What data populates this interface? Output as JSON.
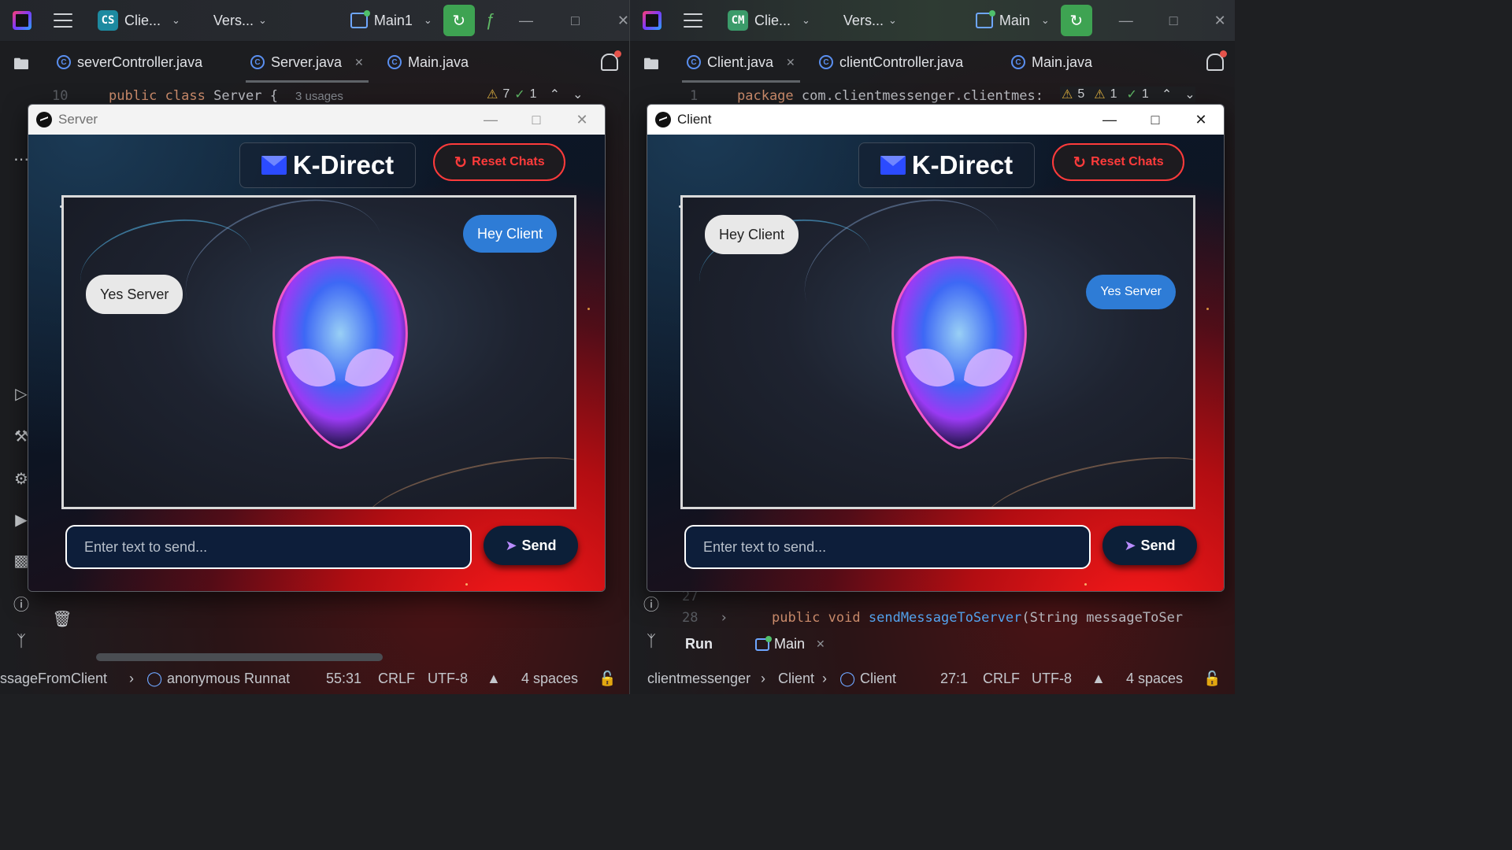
{
  "left_ide": {
    "project_badge": "CS",
    "project_name": "Clie...",
    "vcs_label": "Vers...",
    "run_config": "Main1",
    "tabs": [
      {
        "label": "severController.java",
        "active": false
      },
      {
        "label": "Server.java",
        "active": true
      },
      {
        "label": "Main.java",
        "active": false
      }
    ],
    "code_line_number": "10",
    "code_kw1": "public",
    "code_kw2": "class",
    "code_name": "Server {",
    "code_hint": "3 usages",
    "inspections": {
      "warnings": "7",
      "ok": "1"
    },
    "status": {
      "breadcrumb1": "ssageFromClient",
      "breadcrumb2": "anonymous Runnat",
      "position": "55:31",
      "line_sep": "CRLF",
      "encoding": "UTF-8",
      "indent": "4 spaces"
    }
  },
  "right_ide": {
    "project_badge": "CM",
    "project_name": "Clie...",
    "vcs_label": "Vers...",
    "run_config": "Main",
    "tabs": [
      {
        "label": "Client.java",
        "active": true
      },
      {
        "label": "clientController.java",
        "active": false
      },
      {
        "label": "Main.java",
        "active": false
      }
    ],
    "code_line_number": "1",
    "code_kw": "package",
    "code_rest": "com.clientmessenger.clientmes:",
    "inspections": {
      "errors": "5",
      "warnings": "1",
      "ok": "1"
    },
    "code_line_27": "27",
    "code_line_28": "28",
    "code_28_kw1": "public",
    "code_28_kw2": "void",
    "code_28_fn": "sendMessageToServer",
    "code_28_rest": "(String messageToSer",
    "run_panel": {
      "run_label": "Run",
      "tab_label": "Main"
    },
    "status": {
      "breadcrumb1": "clientmessenger",
      "breadcrumb2": "Client",
      "breadcrumb3": "Client",
      "position": "27:1",
      "line_sep": "CRLF",
      "encoding": "UTF-8",
      "indent": "4 spaces"
    }
  },
  "server_app": {
    "window_title": "Server",
    "brand": "K-Direct",
    "reset_label": "Reset Chats",
    "messages": [
      {
        "text": "Hey Client",
        "from": "self"
      },
      {
        "text": "Yes Server",
        "from": "other"
      }
    ],
    "input_placeholder": "Enter text to send...",
    "send_label": "Send"
  },
  "client_app": {
    "window_title": "Client",
    "brand": "K-Direct",
    "reset_label": "Reset Chats",
    "messages": [
      {
        "text": "Hey Client",
        "from": "other"
      },
      {
        "text": "Yes Server",
        "from": "self"
      }
    ],
    "input_placeholder": "Enter text to send...",
    "send_label": "Send"
  },
  "colors": {
    "accent_red": "#ff3b3b",
    "bubble_self": "#2e7cd6",
    "bubble_other": "#e8e8e8",
    "run_green": "#3ea352"
  }
}
